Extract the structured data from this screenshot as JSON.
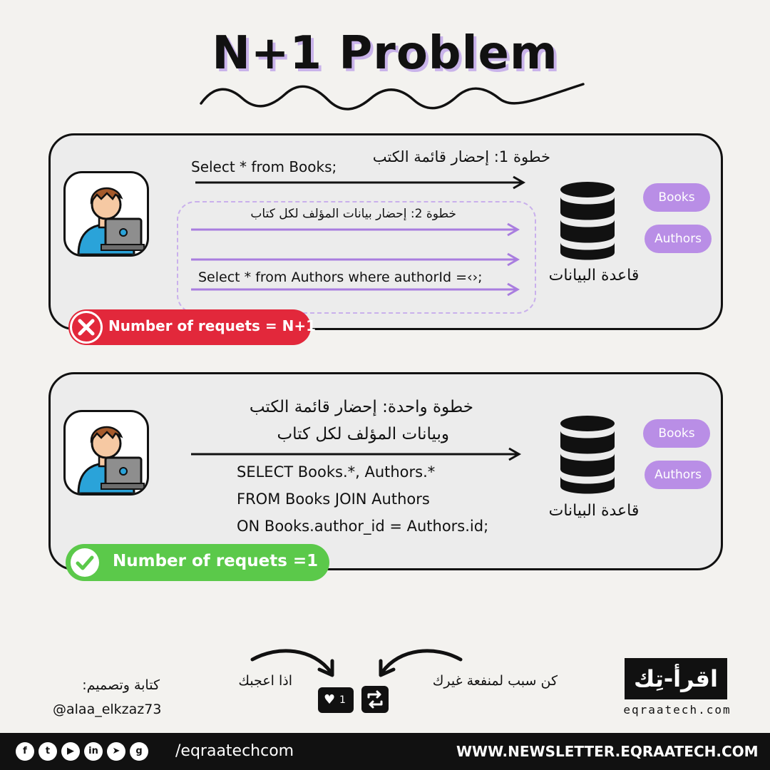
{
  "title": "N+1 Problem",
  "panel1": {
    "step1_label": "خطوة 1: إحضار قائمة الكتب",
    "step1_query": "Select * from Books;",
    "step2_label": "خطوة 2: إحضار بيانات المؤلف لكل كتاب",
    "step2_query": "Select * from Authors where authorId =‹›;",
    "db_label": "قاعدة البيانات",
    "tables": [
      "Books",
      "Authors"
    ],
    "badge": "Number of requets = N+1",
    "badge_color": "#e2283b"
  },
  "panel2": {
    "step_line1": "خطوة واحدة: إحضار قائمة الكتب",
    "step_line2": "وبيانات المؤلف لكل كتاب",
    "query_line1": "SELECT Books.*, Authors.*",
    "query_line2": "FROM Books JOIN Authors",
    "query_line3": "ON Books.author_id = Authors.id;",
    "db_label": "قاعدة البيانات",
    "tables": [
      "Books",
      "Authors"
    ],
    "badge": "Number of requets =1",
    "badge_color": "#5bc94a"
  },
  "footer": {
    "credit_label": "كتابة وتصميم:",
    "credit_handle": "@alaa_elkzaz73",
    "like_text": "اذا اعجبك",
    "share_text": "كن سبب لمنفعة غيرك",
    "like_count": "1",
    "logo_text": "اقرأ-تِك",
    "logo_url": "eqraatech.com",
    "social_handle": "/eqraatechcom",
    "newsletter": "WWW.NEWSLETTER.EQRAATECH.COM",
    "social_icons": [
      "facebook-icon",
      "twitter-icon",
      "youtube-icon",
      "linkedin-icon",
      "telegram-icon",
      "github-icon"
    ]
  },
  "colors": {
    "accent_purple": "#b98ee6",
    "arrow_purple": "#a97ddf",
    "error_red": "#e2283b",
    "success_green": "#5bc94a"
  }
}
